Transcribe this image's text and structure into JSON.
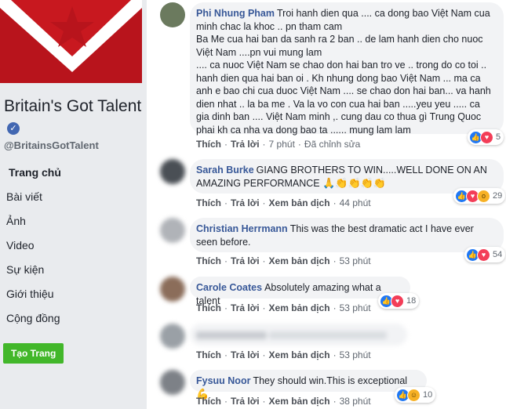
{
  "page": {
    "name": "Britain's Got Talent",
    "handle": "@BritainsGotTalent",
    "verified_icon": "verified-badge-icon",
    "cover_colors": {
      "red": "#b8141c",
      "white": "#ffffff"
    }
  },
  "nav": {
    "items": [
      {
        "label": "Trang chủ",
        "active": true
      },
      {
        "label": "Bài viết"
      },
      {
        "label": "Ảnh"
      },
      {
        "label": "Video"
      },
      {
        "label": "Sự kiện"
      },
      {
        "label": "Giới thiệu"
      },
      {
        "label": "Cộng đồng"
      }
    ],
    "create_page": "Tạo Trang"
  },
  "comments": [
    {
      "author": "Phi Nhung Pham",
      "text": "Troi hanh dien qua .... ca dong bao Việt Nam cua minh chac la khoc .. pn tham cam\nBa Me cua hai ban da sanh ra 2 ban .. de lam hanh dien cho nuoc Việt Nam ....pn vui mung lam\n.... ca nuoc Việt Nam se chao don hai ban tro ve .. trong do co toi .. hanh dien qua hai ban oi . Kh nhung dong bao Việt Nam ... ma ca anh e bao chi cua duoc Việt Nam .... se chao don hai ban... va hanh dien nhat .. la ba me . Va la vo con cua hai ban .....yeu yeu ..... ca gia dinh ban .... Việt Nam minh ,. cung dau co thua gì Trung Quoc phai kh ca nha va dong bao ta ...... mung lam lam",
      "like": "Thích",
      "reply": "Trả lời",
      "time": "7 phút",
      "edited": "Đã chỉnh sửa",
      "reaction_count": "5"
    },
    {
      "author": "Sarah Burke",
      "text": "GIANG BROTHERS TO WIN.....WELL DONE ON AN AMAZING PERFORMANCE",
      "like": "Thích",
      "reply": "Trả lời",
      "translate": "Xem bản dịch",
      "time": "44 phút",
      "reaction_count": "29"
    },
    {
      "author": "Christian Herrmann",
      "text": "This was the best dramatic act I have ever seen before.",
      "like": "Thích",
      "reply": "Trả lời",
      "translate": "Xem bản dịch",
      "time": "53 phút",
      "reaction_count": "54"
    },
    {
      "author": "Carole Coates",
      "text": "Absolutely amazing what a talent",
      "like": "Thích",
      "reply": "Trả lời",
      "translate": "Xem bản dịch",
      "time": "53 phút",
      "reaction_count": "18"
    },
    {
      "like": "Thích",
      "reply": "Trả lời",
      "translate": "Xem bản dịch",
      "time": "53 phút"
    },
    {
      "author": "Fysuu Noor",
      "text": "They should win.This is exceptional",
      "like": "Thích",
      "reply": "Trả lời",
      "translate": "Xem bản dịch",
      "time": "38 phút",
      "reaction_count": "10"
    }
  ],
  "colors": {
    "link_blue": "#385898",
    "green_button": "#42b72a",
    "like_blue": "#2078f4",
    "love_red": "#f33e58"
  }
}
